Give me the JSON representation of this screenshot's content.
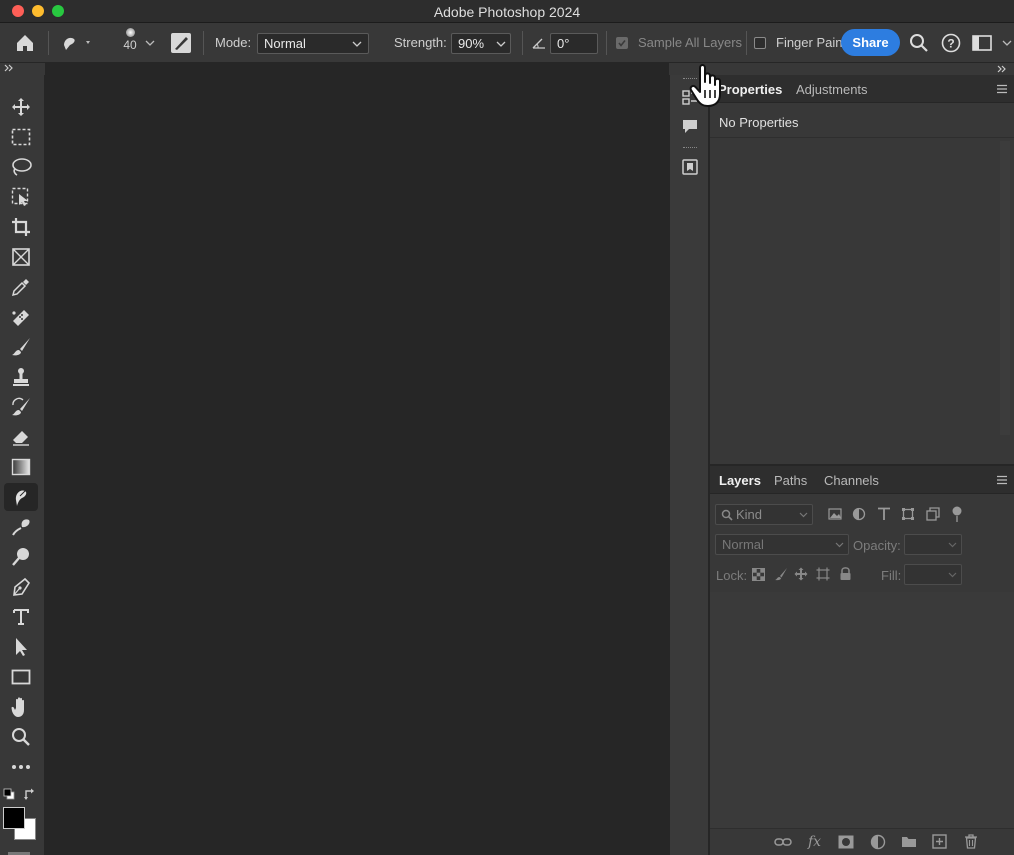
{
  "window": {
    "title": "Adobe Photoshop 2024"
  },
  "options_bar": {
    "brush_size": "40",
    "mode_label": "Mode:",
    "mode_value": "Normal",
    "strength_label": "Strength:",
    "strength_value": "90%",
    "angle_value": "0°",
    "sample_all_layers_label": "Sample All Layers",
    "sample_all_layers_checked": true,
    "finger_paint_label": "Finger Paint",
    "finger_paint_checked": false,
    "share_label": "Share"
  },
  "toolbar": {
    "tools": [
      {
        "name": "move-tool",
        "icon": "move-icon"
      },
      {
        "name": "rectangular-marquee-tool",
        "icon": "marquee-icon"
      },
      {
        "name": "lasso-tool",
        "icon": "lasso-icon"
      },
      {
        "name": "object-selection-tool",
        "icon": "object-selection-icon"
      },
      {
        "name": "crop-tool",
        "icon": "crop-icon"
      },
      {
        "name": "frame-tool",
        "icon": "frame-icon"
      },
      {
        "name": "eyedropper-tool",
        "icon": "eyedropper-icon"
      },
      {
        "name": "spot-healing-tool",
        "icon": "bandage-icon"
      },
      {
        "name": "brush-tool",
        "icon": "brush-icon"
      },
      {
        "name": "clone-stamp-tool",
        "icon": "stamp-icon"
      },
      {
        "name": "history-brush-tool",
        "icon": "history-brush-icon"
      },
      {
        "name": "eraser-tool",
        "icon": "eraser-icon"
      },
      {
        "name": "gradient-tool",
        "icon": "gradient-icon"
      },
      {
        "name": "smudge-tool",
        "icon": "smudge-icon",
        "active": true
      },
      {
        "name": "dodge-tool",
        "icon": "dodge-icon"
      },
      {
        "name": "pen-tool",
        "icon": "pen-icon"
      },
      {
        "name": "type-tool",
        "icon": "type-icon"
      },
      {
        "name": "path-selection-tool",
        "icon": "arrow-icon"
      },
      {
        "name": "rectangle-tool",
        "icon": "rectangle-icon"
      },
      {
        "name": "hand-tool",
        "icon": "hand-icon"
      },
      {
        "name": "zoom-tool",
        "icon": "zoom-icon"
      },
      {
        "name": "edit-toolbar",
        "icon": "more-icon"
      }
    ],
    "foreground_color": "#000000",
    "background_color": "#ffffff"
  },
  "properties_panel": {
    "tabs": [
      "Properties",
      "Adjustments"
    ],
    "active_tab": "Properties",
    "content": "No Properties"
  },
  "layers_panel": {
    "tabs": [
      "Layers",
      "Paths",
      "Channels"
    ],
    "active_tab": "Layers",
    "filter_placeholder": "Kind",
    "blend_mode": "Normal",
    "opacity_label": "Opacity:",
    "lock_label": "Lock:",
    "fill_label": "Fill:"
  },
  "colors": {
    "accent_blue": "#2d7de0"
  }
}
